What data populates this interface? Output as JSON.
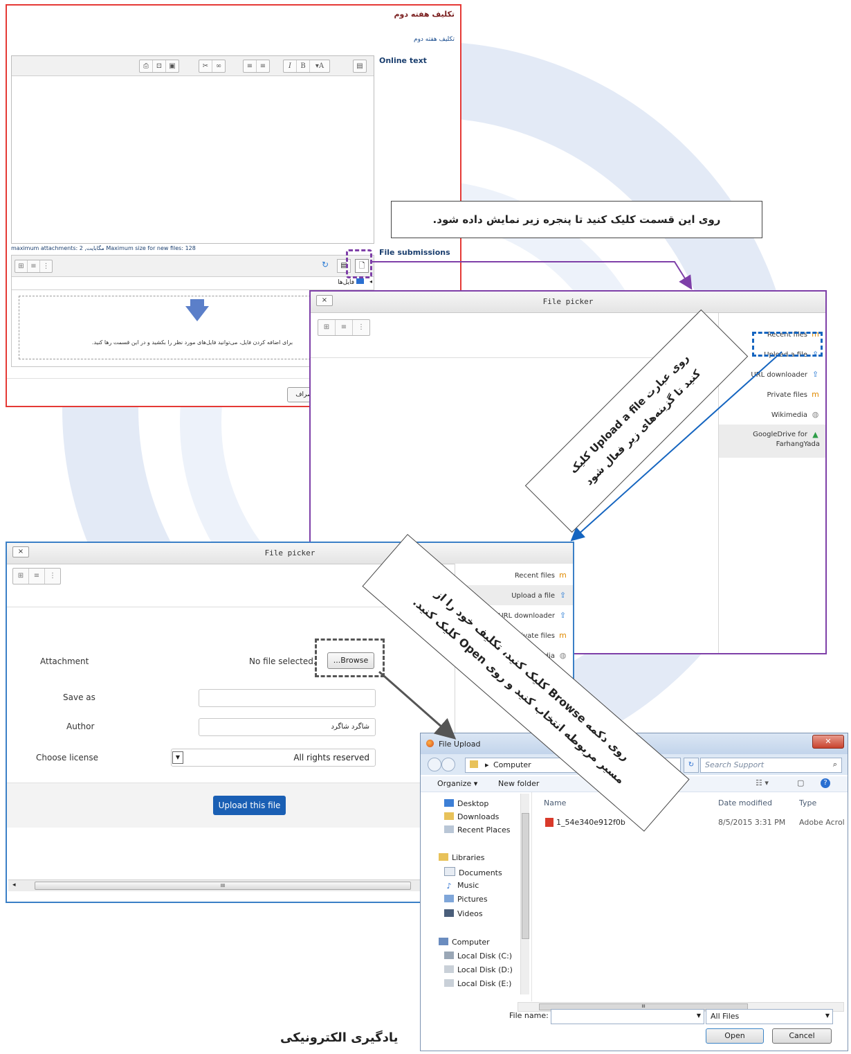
{
  "assignment": {
    "title": "تکلیف هفته دوم",
    "subtitle": "تکلیف هفته دوم",
    "online_text_label": "Online text",
    "editor_tools": [
      "▢",
      "⊞",
      "▣",
      "⛓",
      "🔗",
      "☰",
      "☰",
      "I",
      "B",
      "▾A",
      "▤"
    ],
    "limits_text": "maximum attachments: 2 ,مگابایت Maximum size for new files: 128",
    "file_submissions_label": "File submissions",
    "files_folder": "فایل‌ها",
    "drop_hint": "برای اضافه کردن فایل، می‌توانید فایل‌های مورد نظر را بکشید و در این قسمت رها کنید.",
    "cancel_button": "انصراف"
  },
  "callout1": "روی این قسمت کلیک کنید تا پنجره زیر نمایش داده شود.",
  "callout2_lines": [
    "روی عبارت Upload a file کلیک",
    "کنید تا گزینه‌های زیر فعال شود"
  ],
  "callout3_lines": [
    "روی دکمه Browse کلیک کنید، تکلیف خود را از",
    "مسیر مربوطه انتخاب کنید و روی Open کلیک کنید."
  ],
  "picker": {
    "title": "File picker",
    "close": "×",
    "repos": [
      {
        "label": "Recent files",
        "icon": "moodle-icon"
      },
      {
        "label": "Upload a file",
        "icon": "upload-icon"
      },
      {
        "label": "URL downloader",
        "icon": "url-icon"
      },
      {
        "label": "Private files",
        "icon": "moodle-icon"
      },
      {
        "label": "Wikimedia",
        "icon": "wikimedia-icon"
      },
      {
        "label": "GoogleDrive for FarhangYada",
        "icon": "gdrive-icon"
      }
    ]
  },
  "upload_form": {
    "attachment_label": "Attachment",
    "no_file": "No file selected.",
    "browse": "...Browse",
    "save_as_label": "Save as",
    "author_label": "Author",
    "author_value": "شاگرد شاگرد",
    "license_label": "Choose license",
    "license_value": "All rights reserved",
    "upload_button": "Upload this file",
    "scroll_mark": "III"
  },
  "file_upload": {
    "title": "File Upload",
    "breadcrumb": "Computer",
    "search_placeholder": "Search Support",
    "organize": "Organize ▾",
    "new_folder": "New folder",
    "nav": {
      "favorites": [
        "Desktop",
        "Downloads",
        "Recent Places"
      ],
      "libraries_header": "Libraries",
      "libraries": [
        "Documents",
        "Music",
        "Pictures",
        "Videos"
      ],
      "computer_header": "Computer",
      "drives": [
        "Local Disk (C:)",
        "Local Disk (D:)",
        "Local Disk (E:)"
      ]
    },
    "columns": {
      "name": "Name",
      "date": "Date modified",
      "type": "Type"
    },
    "file": {
      "name": "1_54e340e912f0b",
      "date": "8/5/2015 3:31 PM",
      "type": "Adobe Acrol"
    },
    "file_name_label": "File name:",
    "file_name_value": "",
    "filter": "All Files",
    "open": "Open",
    "cancel": "Cancel",
    "scroll_mark": "III"
  },
  "footer_text": "یادگیری الکترونیکی",
  "colors": {
    "frame_red": "#e53935",
    "purple": "#7e3fa8",
    "blue": "#1565c0",
    "moodle_blue": "#1565c0"
  }
}
